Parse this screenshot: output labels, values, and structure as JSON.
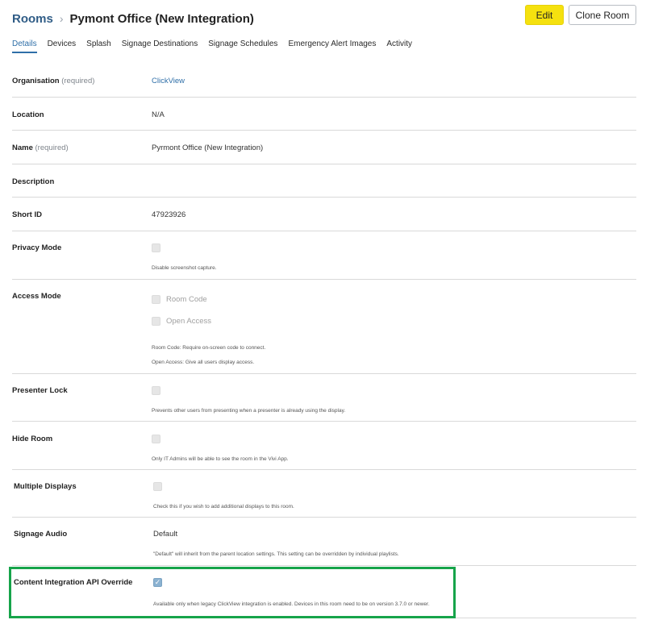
{
  "breadcrumb": {
    "root": "Rooms",
    "separator": "›",
    "current": "Pymont Office (New Integration)"
  },
  "actions": {
    "edit_label": "Edit",
    "clone_label": "Clone Room",
    "edit_color": "#f5e10f"
  },
  "tabs": [
    {
      "label": "Details",
      "active": true
    },
    {
      "label": "Devices"
    },
    {
      "label": "Splash"
    },
    {
      "label": "Signage Destinations"
    },
    {
      "label": "Signage Schedules"
    },
    {
      "label": "Emergency Alert Images"
    },
    {
      "label": "Activity"
    }
  ],
  "fields": {
    "organisation": {
      "label": "Organisation",
      "required": "(required)",
      "value": "ClickView"
    },
    "location": {
      "label": "Location",
      "value": "N/A"
    },
    "name": {
      "label": "Name",
      "required": "(required)",
      "value": "Pyrmont Office (New Integration)"
    },
    "description": {
      "label": "Description",
      "value": ""
    },
    "short_id": {
      "label": "Short ID",
      "value": "47923926"
    },
    "privacy_mode": {
      "label": "Privacy Mode",
      "checked": false,
      "help": "Disable screenshot capture."
    },
    "access_mode": {
      "label": "Access Mode",
      "options": [
        {
          "label": "Room Code",
          "checked": false
        },
        {
          "label": "Open Access",
          "checked": false
        }
      ],
      "help1": "Room Code: Require on-screen code to connect.",
      "help2": "Open Access: Give all users display access."
    },
    "presenter_lock": {
      "label": "Presenter Lock",
      "checked": false,
      "help": "Prevents other users from presenting when a presenter is already using the display."
    },
    "hide_room": {
      "label": "Hide Room",
      "checked": false,
      "help": "Only IT Admins will be able to see the room in the Vivi App."
    },
    "multiple_displays": {
      "label": "Multiple Displays",
      "checked": false,
      "help": "Check this if you wish to add additional displays to this room."
    },
    "signage_audio": {
      "label": "Signage Audio",
      "value": "Default",
      "help": "\"Default\" will inherit from the parent location settings. This setting can be overridden by individual playlists."
    },
    "content_integration": {
      "label": "Content Integration API Override",
      "checked": true,
      "check_glyph": "✓",
      "help": "Available only when legacy ClickView integration is enabled. Devices in this room need to be on version 3.7.0 or newer."
    }
  },
  "colors": {
    "link": "#2f6fa8",
    "highlight": "#16a44a"
  }
}
